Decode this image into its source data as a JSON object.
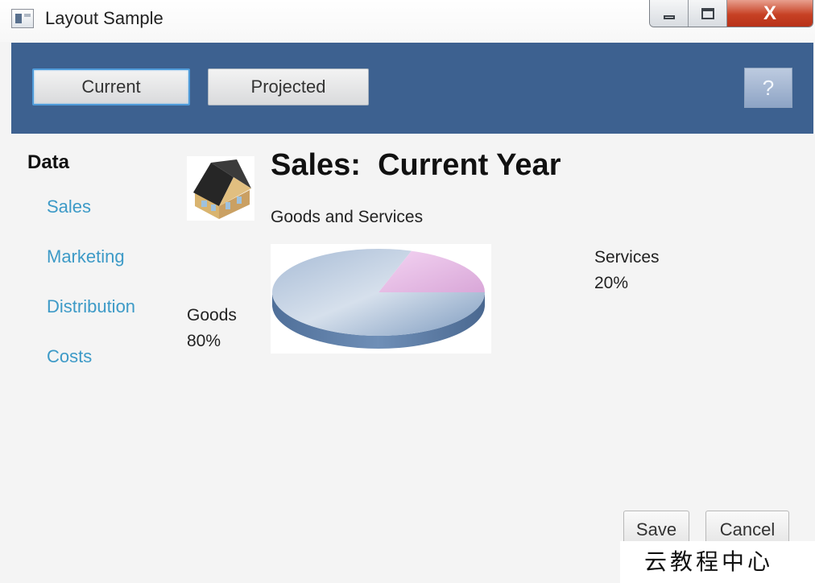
{
  "window": {
    "title": "Layout Sample",
    "controls": {
      "minimize": "minimize",
      "maximize": "maximize",
      "close": "X"
    }
  },
  "header": {
    "tabs": [
      {
        "label": "Current",
        "selected": true
      },
      {
        "label": "Projected",
        "selected": false
      }
    ],
    "help_label": "?",
    "background": "#3d6190"
  },
  "sidebar": {
    "title": "Data",
    "items": [
      {
        "label": "Sales"
      },
      {
        "label": "Marketing"
      },
      {
        "label": "Distribution"
      },
      {
        "label": "Costs"
      }
    ],
    "link_color": "#3d9ac7"
  },
  "main": {
    "icon": "house-icon",
    "title": "Sales:  Current Year",
    "subtitle": "Goods and Services"
  },
  "chart_data": {
    "type": "pie",
    "title": "",
    "slices": [
      {
        "name": "Goods",
        "label": "Goods",
        "value_label": "80%",
        "value": 80,
        "color": "#8ea7c6"
      },
      {
        "name": "Services",
        "label": "Services",
        "value_label": "20%",
        "value": 20,
        "color": "#e8bde8"
      }
    ]
  },
  "actions": {
    "save_label": "Save",
    "cancel_label": "Cancel"
  },
  "watermark": {
    "text": "云教程中心"
  }
}
